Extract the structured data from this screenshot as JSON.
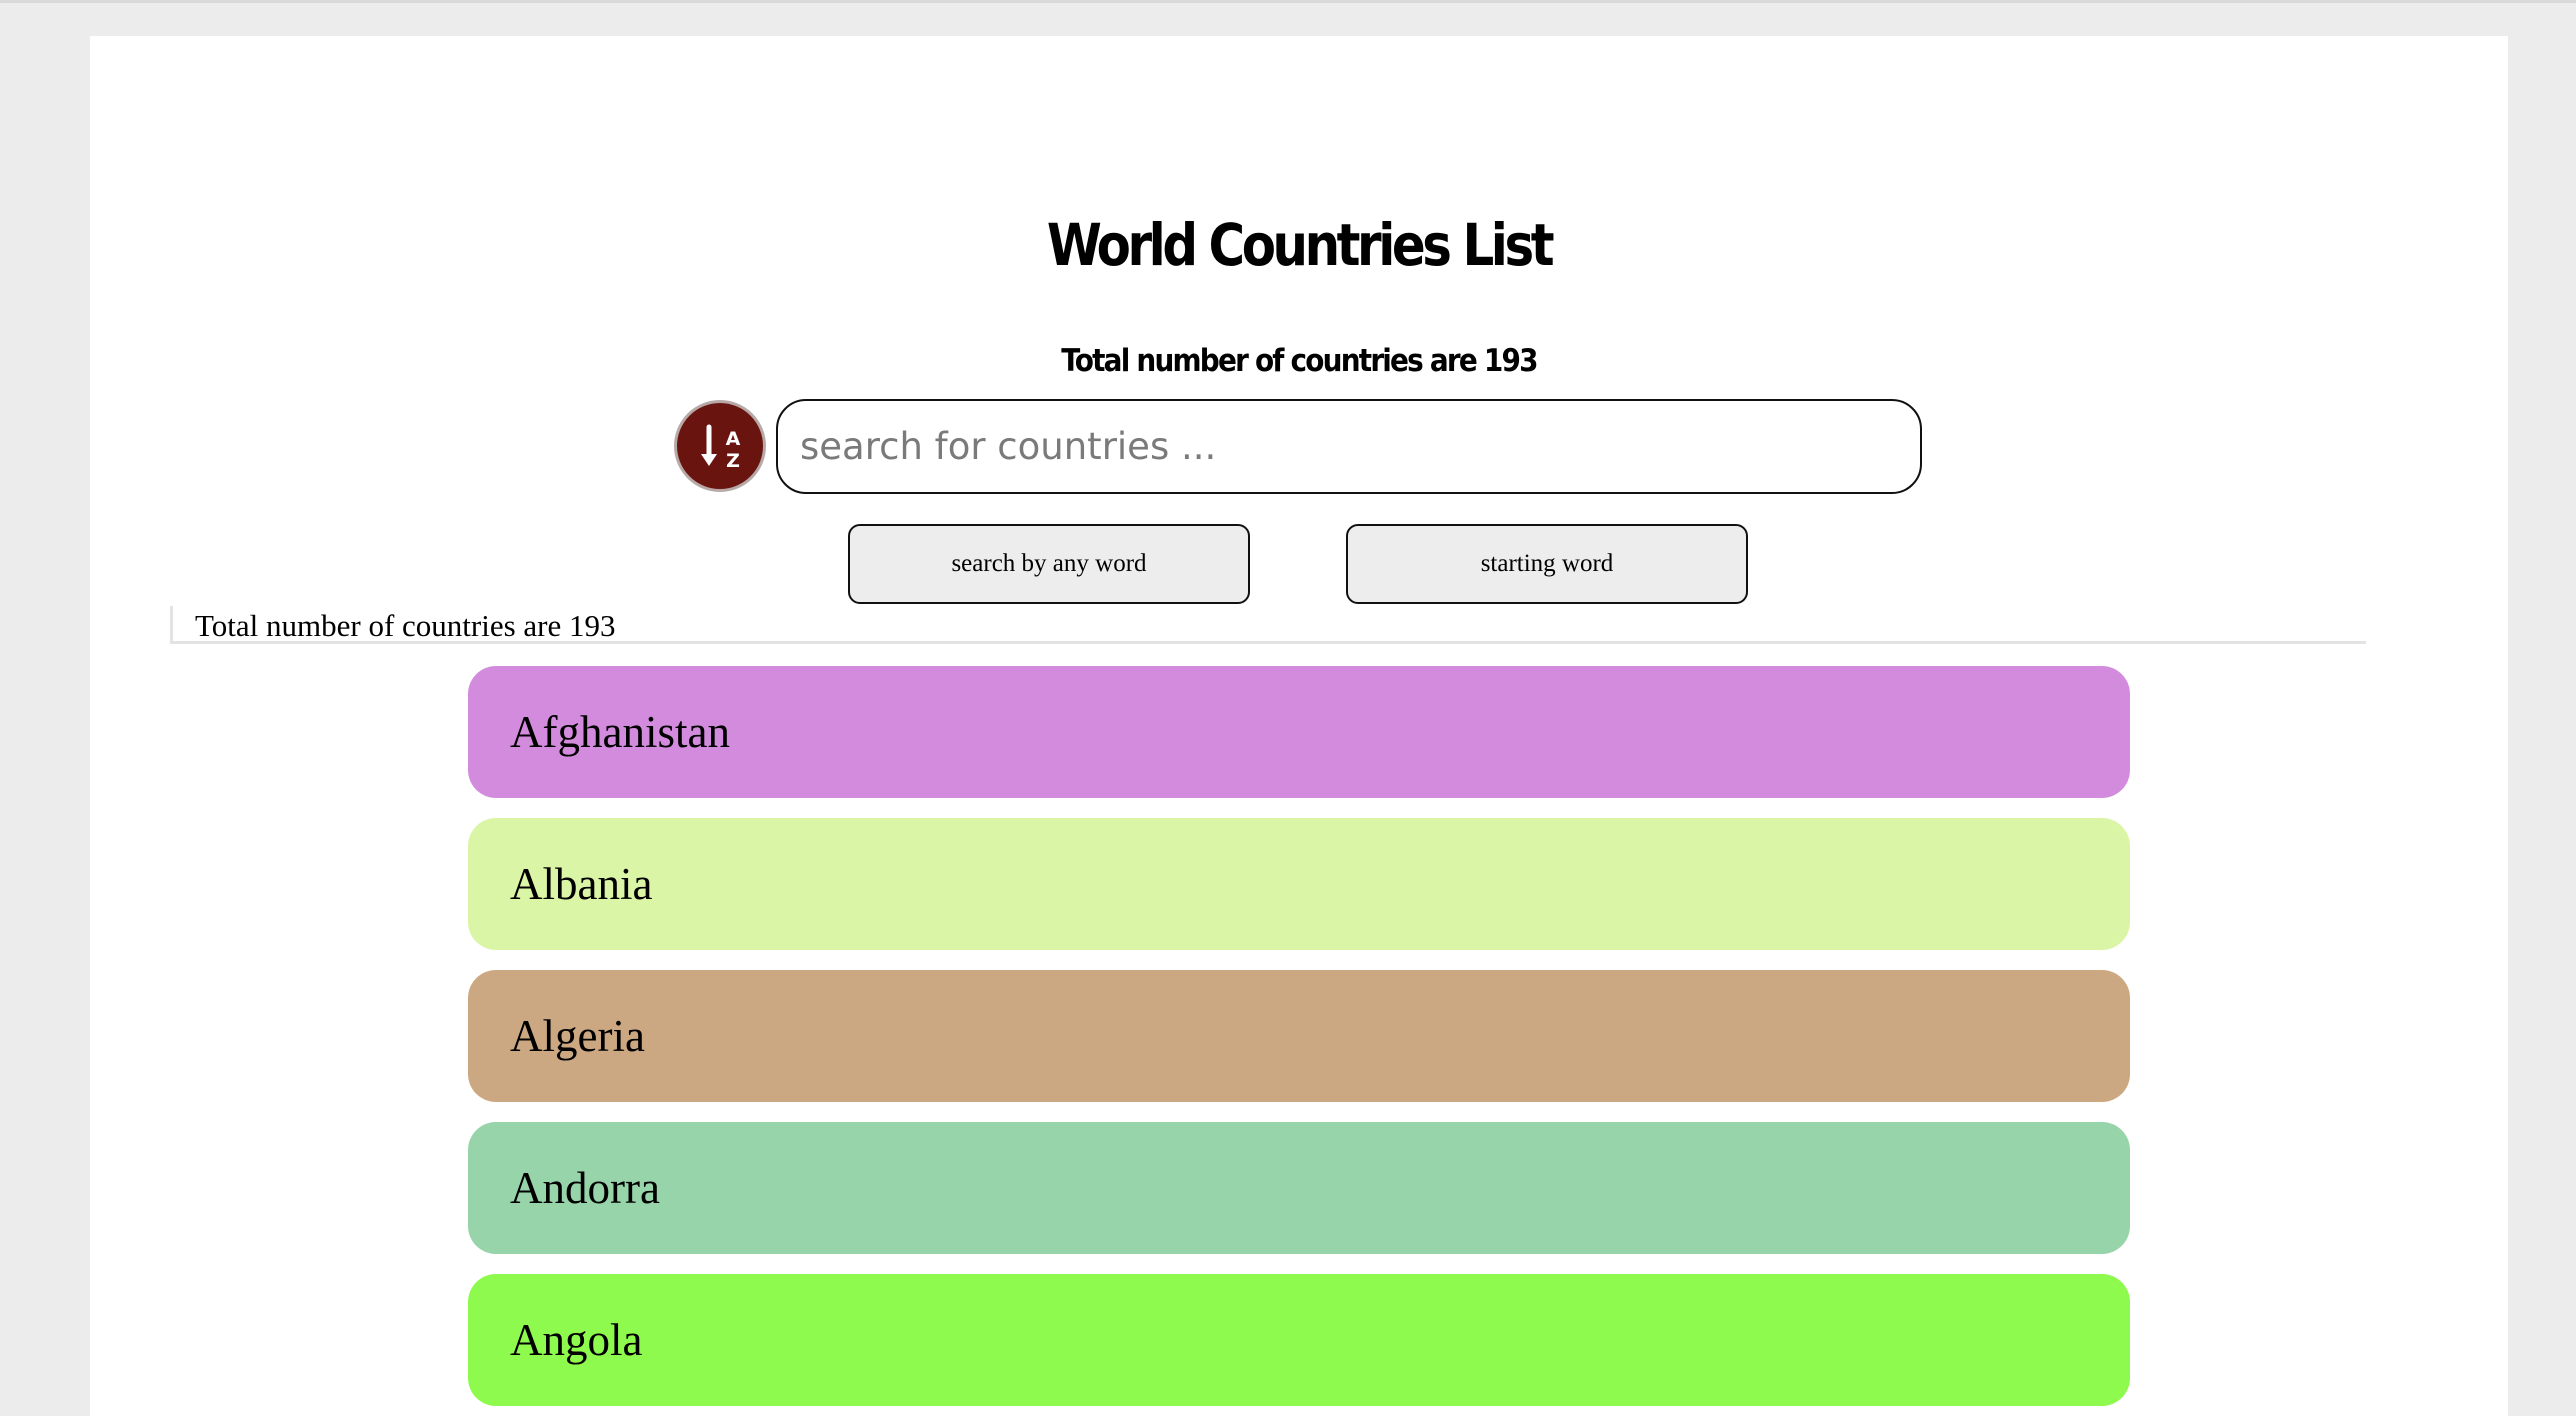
{
  "header": {
    "title": "World Countries List",
    "subtitle": "Total number of countries are 193"
  },
  "search": {
    "sort_icon": "sort-alpha-down-icon",
    "placeholder": "search for countries ...",
    "value": ""
  },
  "modes": {
    "any_word_label": "search by any word",
    "starting_word_label": "starting word"
  },
  "results": {
    "count_text": "Total number of countries are 193"
  },
  "countries": [
    {
      "name": "Afghanistan",
      "color": "#d38cdd"
    },
    {
      "name": "Albania",
      "color": "#dbf5a6"
    },
    {
      "name": "Algeria",
      "color": "#cba882"
    },
    {
      "name": "Andorra",
      "color": "#97d4a9"
    },
    {
      "name": "Angola",
      "color": "#8ffa4e"
    }
  ],
  "colors": {
    "sort_button": "#6a1410",
    "page_background": "#ececec",
    "content_background": "#ffffff"
  }
}
